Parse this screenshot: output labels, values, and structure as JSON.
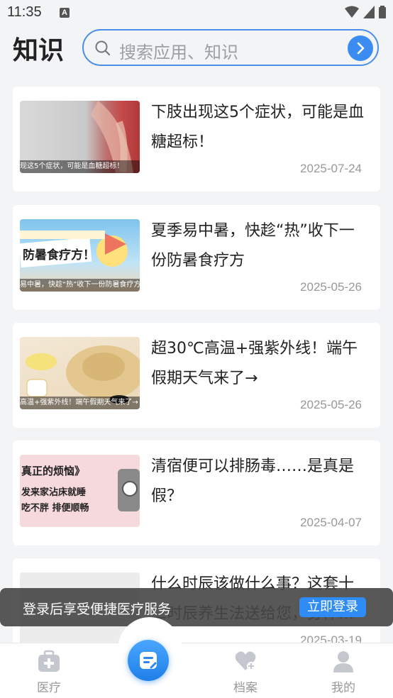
{
  "status_bar": {
    "time": "11:35",
    "a_badge": "A"
  },
  "header": {
    "title": "知识",
    "search_placeholder": "搜索应用、知识"
  },
  "articles": [
    {
      "title": "下肢出现这5个症状，可能是血糖超标！",
      "date": "2025-07-24",
      "caption": "现这5个症状，可能是血糖超标！"
    },
    {
      "title": "夏季易中暑，快趁“热”收下一份防暑食疗方",
      "date": "2025-05-26",
      "caption": "易中暑，快趁“热”收下一份防暑食疗方",
      "image_text": "防暑食疗方！"
    },
    {
      "title": "超30℃高温+强紫外线！端午假期天气来了→",
      "date": "2025-05-26",
      "caption": "高温+强紫外线！端午假期天气来了→"
    },
    {
      "title": "清宿便可以排肠毒……是真是假？",
      "date": "2025-04-07",
      "image_text_1": "真正的烦恼》",
      "image_text_2": "发来家沾床就睡",
      "image_text_3": "吃不胖 排便顺畅"
    },
    {
      "title": "什么时辰该做什么事？这套十二时辰养生法送给您，身体…",
      "date": "2025-03-19"
    }
  ],
  "login_banner": {
    "text": "登录后享受便捷医疗服务",
    "button": "立即登录"
  },
  "tabbar": {
    "items": [
      {
        "label": "医疗"
      },
      {
        "label": "档案"
      },
      {
        "label": "我的"
      }
    ]
  },
  "colors": {
    "accent": "#3b8cf0",
    "search_border": "#4a8ee6"
  }
}
